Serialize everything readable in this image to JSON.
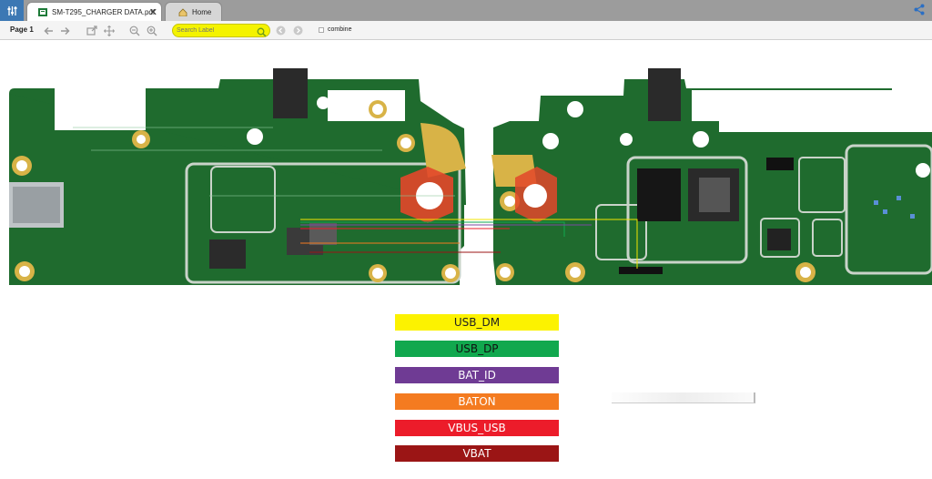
{
  "tabs": [
    {
      "label": "SM-T295_CHARGER DATA.pdf",
      "icon": "pdf-file-icon",
      "active": true
    },
    {
      "label": "Home",
      "icon": "home-icon",
      "active": false
    }
  ],
  "toolbar": {
    "page_label": "Page 1",
    "search_placeholder": "Search Label",
    "combine_label": "combine"
  },
  "legend": [
    {
      "label": "USB_DM",
      "color": "#fcf200"
    },
    {
      "label": "USB_DP",
      "color": "#11a84e"
    },
    {
      "label": "BAT_ID",
      "color": "#6f3b94"
    },
    {
      "label": "BATON",
      "color": "#f47b20"
    },
    {
      "label": "VBUS_USB",
      "color": "#ec1c2a"
    },
    {
      "label": "VBAT",
      "color": "#9b1515"
    }
  ],
  "colors": {
    "pcb_green": "#1f6b2e",
    "gold_pad": "#d8b347",
    "tab_bar": "#9c9c9c",
    "search_bg": "#f4f300",
    "app_blue": "#3c78b4"
  }
}
